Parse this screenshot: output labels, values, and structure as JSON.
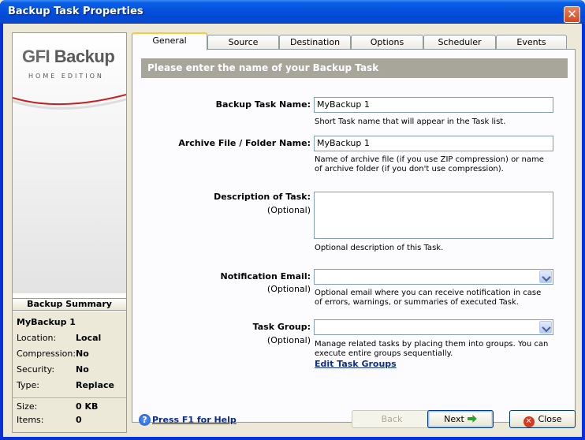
{
  "window": {
    "title": "Backup Task Properties",
    "close_glyph": "✕"
  },
  "sidebar": {
    "logo_brand": "GFI",
    "logo_product": "Backup",
    "logo_edition": "HOME EDITION",
    "summary_title": "Backup Summary",
    "task_name": "MyBackup 1",
    "rows": [
      {
        "key": "Location:",
        "value": "Local"
      },
      {
        "key": "Compression:",
        "value": "No"
      },
      {
        "key": "Security:",
        "value": "No"
      },
      {
        "key": "Type:",
        "value": "Replace"
      },
      {
        "key": "Size:",
        "value": "0 KB"
      },
      {
        "key": "Items:",
        "value": "0"
      }
    ]
  },
  "tabs": [
    {
      "label": "General",
      "active": true
    },
    {
      "label": "Source",
      "active": false
    },
    {
      "label": "Destination",
      "active": false
    },
    {
      "label": "Options",
      "active": false
    },
    {
      "label": "Scheduler",
      "active": false
    },
    {
      "label": "Events",
      "active": false
    }
  ],
  "general": {
    "banner": "Please enter the name of your Backup Task",
    "task_name_label": "Backup Task Name:",
    "task_name_value": "MyBackup 1",
    "task_name_hint": "Short Task name that will appear in the Task list.",
    "archive_label": "Archive File / Folder Name:",
    "archive_value": "MyBackup 1",
    "archive_hint": "Name of archive file (if you use ZIP compression) or name of archive folder (if you don't use compression).",
    "description_label": "Description of Task:",
    "description_optional": "(Optional)",
    "description_value": "",
    "description_hint": "Optional description of this Task.",
    "email_label": "Notification Email:",
    "email_optional": "(Optional)",
    "email_value": "",
    "email_hint": "Optional email where you can receive notification in case of errors, warnings, or summaries of executed Task.",
    "group_label": "Task Group:",
    "group_optional": "(Optional)",
    "group_value": "",
    "group_hint": "Manage related tasks by placing them into groups. You can execute entire groups sequentially.",
    "edit_groups_link": "Edit Task Groups"
  },
  "footer": {
    "help_icon": "?",
    "help_text": "Press F1 for Help",
    "back_label": "Back",
    "next_label": "Next",
    "close_label": "Close",
    "close_icon": "✕"
  },
  "icons": [
    "close-icon",
    "help-icon",
    "next-arrow-icon",
    "close-x-icon",
    "dropdown-arrow-icon"
  ],
  "colors": {
    "titlebar": "#0553e0",
    "banner": "#a8a69b",
    "link": "#0b2c8a",
    "active_tab_accent": "#ffc83c"
  }
}
